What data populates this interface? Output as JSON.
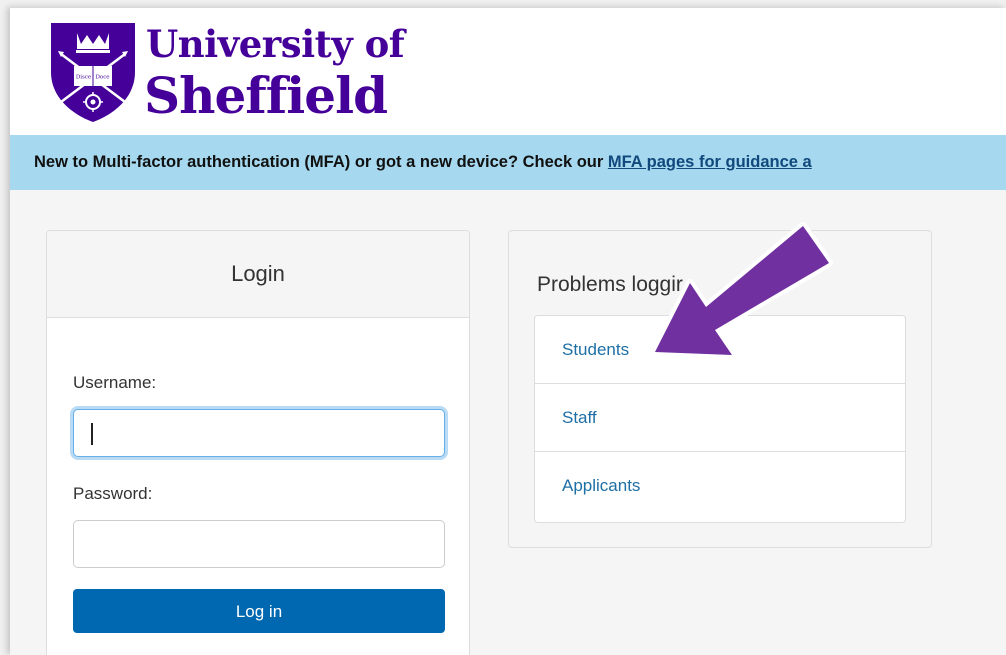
{
  "header": {
    "logo": {
      "line1": "University of",
      "line2": "Sheffield",
      "crest_text": "Disce Doce",
      "brand_color": "#440099"
    }
  },
  "banner": {
    "text": "New to Multi-factor authentication (MFA) or got a new device? Check our ",
    "link_text": "MFA pages for guidance a",
    "background": "#a6d9ef"
  },
  "login": {
    "title": "Login",
    "username_label": "Username:",
    "username_value": "",
    "password_label": "Password:",
    "password_value": "",
    "submit_label": "Log in",
    "button_color": "#0067b1"
  },
  "help": {
    "title": "Problems loggir",
    "items": [
      {
        "label": "Students"
      },
      {
        "label": "Staff"
      },
      {
        "label": "Applicants"
      }
    ],
    "link_color": "#1d6fa5"
  },
  "annotation": {
    "icon": "arrow-icon",
    "color": "#7030a0"
  }
}
